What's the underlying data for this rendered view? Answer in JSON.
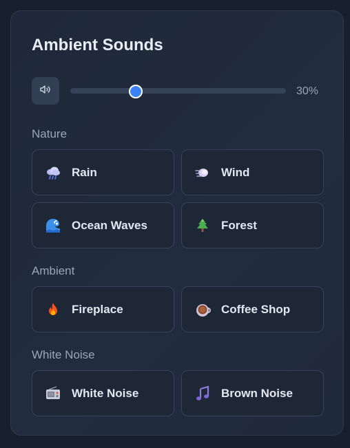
{
  "panel": {
    "title": "Ambient Sounds"
  },
  "volume": {
    "icon": "speaker-icon",
    "level": 0.3,
    "display": "30%"
  },
  "sections": [
    {
      "label": "Nature",
      "sounds": [
        {
          "label": "Rain",
          "icon": "rain-cloud-icon"
        },
        {
          "label": "Wind",
          "icon": "wind-icon"
        },
        {
          "label": "Ocean Waves",
          "icon": "wave-icon"
        },
        {
          "label": "Forest",
          "icon": "tree-icon"
        }
      ]
    },
    {
      "label": "Ambient",
      "sounds": [
        {
          "label": "Fireplace",
          "icon": "fire-icon"
        },
        {
          "label": "Coffee Shop",
          "icon": "coffee-icon"
        }
      ]
    },
    {
      "label": "White Noise",
      "sounds": [
        {
          "label": "White Noise",
          "icon": "radio-icon"
        },
        {
          "label": "Brown Noise",
          "icon": "music-note-icon"
        }
      ]
    }
  ],
  "colors": {
    "accent": "#3b82f6",
    "card_bg": "#1d2736",
    "border": "#364357"
  }
}
